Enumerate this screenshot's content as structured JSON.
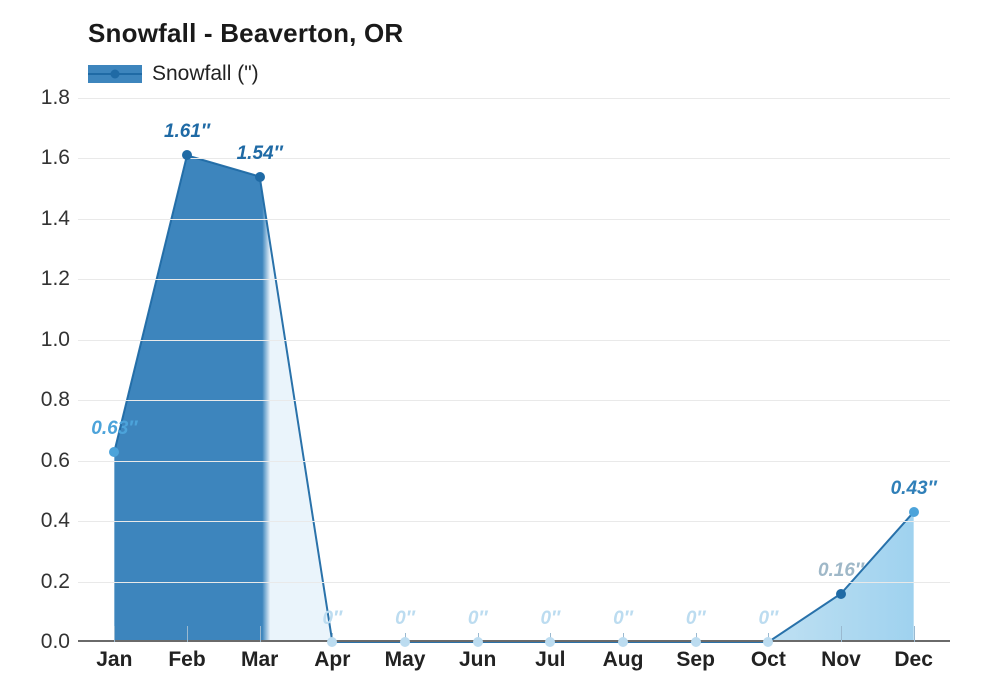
{
  "chart": {
    "title": "Snowfall - Beaverton, OR",
    "legend": {
      "label": "Snowfall (\")",
      "position": "top-left"
    }
  },
  "chart_data": {
    "type": "area",
    "title": "Snowfall - Beaverton, OR",
    "xlabel": "",
    "ylabel": "",
    "categories": [
      "Jan",
      "Feb",
      "Mar",
      "Apr",
      "May",
      "Jun",
      "Jul",
      "Aug",
      "Sep",
      "Oct",
      "Nov",
      "Dec"
    ],
    "values": [
      0.63,
      1.61,
      1.54,
      0,
      0,
      0,
      0,
      0,
      0,
      0,
      0.16,
      0.43
    ],
    "data_labels": [
      "0.63″",
      "1.61″",
      "1.54″",
      "0″",
      "0″",
      "0″",
      "0″",
      "0″",
      "0″",
      "0″",
      "0.16″",
      "0.43″"
    ],
    "series": [
      {
        "name": "Snowfall (\")",
        "values": [
          0.63,
          1.61,
          1.54,
          0,
          0,
          0,
          0,
          0,
          0,
          0,
          0.16,
          0.43
        ]
      }
    ],
    "ylim": [
      0,
      1.8
    ],
    "yticks": [
      "0.0",
      "0.2",
      "0.4",
      "0.6",
      "0.8",
      "1.0",
      "1.2",
      "1.4",
      "1.6",
      "1.8"
    ],
    "grid": true,
    "colors": {
      "line": "#1f6aa5",
      "fill": "#3d85bd",
      "label": "#1f6aa5",
      "label_muted": "#9cc3dc",
      "grid": "#e9e9e9",
      "axis": "#6a6a6a"
    }
  }
}
